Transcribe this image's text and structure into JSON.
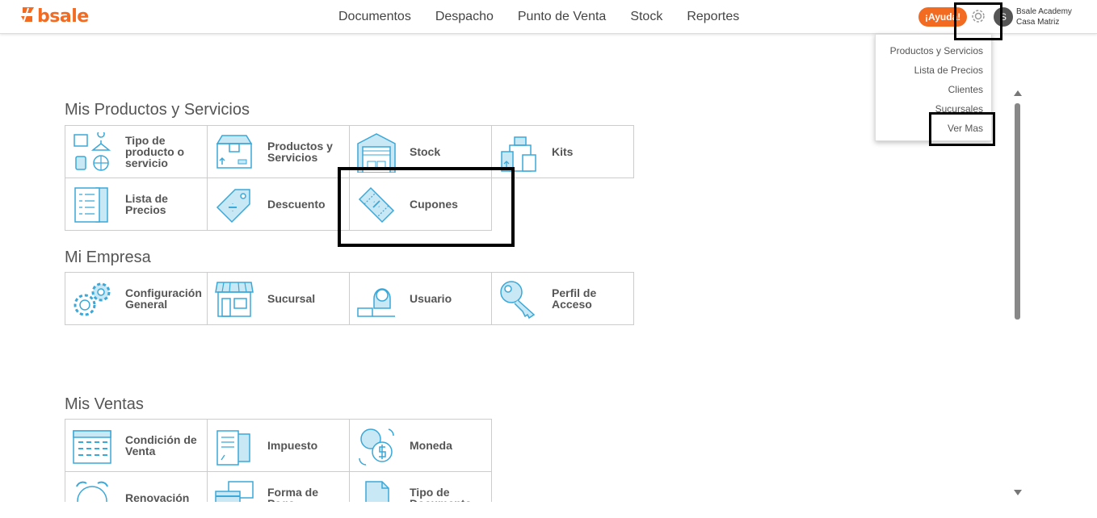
{
  "header": {
    "logo": "bsale",
    "nav": [
      "Documentos",
      "Despacho",
      "Punto de Venta",
      "Stock",
      "Reportes"
    ],
    "help": "¡Ayuda!",
    "avatar_initial": "S",
    "company_name": "Bsale Academy",
    "branch_name": "Casa Matriz"
  },
  "settings_menu": {
    "items": [
      "Productos y Servicios",
      "Lista de Precios",
      "Clientes",
      "Sucursales",
      "Ver Mas"
    ]
  },
  "sections": {
    "productos": {
      "title": "Mis Productos y Servicios",
      "tiles": [
        {
          "label": "Tipo de producto o servicio",
          "icon": "product-type-icon"
        },
        {
          "label": "Productos y Servicios",
          "icon": "box-icon"
        },
        {
          "label": "Stock",
          "icon": "warehouse-icon"
        },
        {
          "label": "Kits",
          "icon": "kits-icon"
        },
        {
          "label": "Lista de Precios",
          "icon": "price-list-icon"
        },
        {
          "label": "Descuento",
          "icon": "discount-tag-icon"
        },
        {
          "label": "Cupones",
          "icon": "coupon-icon"
        }
      ]
    },
    "empresa": {
      "title": "Mi Empresa",
      "tiles": [
        {
          "label": "Configuración General",
          "icon": "gears-icon"
        },
        {
          "label": "Sucursal",
          "icon": "store-icon"
        },
        {
          "label": "Usuario",
          "icon": "user-icon"
        },
        {
          "label": "Perfil de Acceso",
          "icon": "key-icon"
        }
      ]
    },
    "ventas": {
      "title": "Mis Ventas",
      "tiles": [
        {
          "label": "Condición de Venta",
          "icon": "calendar-icon"
        },
        {
          "label": "Impuesto",
          "icon": "tax-icon"
        },
        {
          "label": "Moneda",
          "icon": "currency-icon"
        },
        {
          "label": "Renovación",
          "icon": "clock-icon"
        },
        {
          "label": "Forma de Pago",
          "icon": "payment-icon"
        },
        {
          "label": "Tipo de Documento",
          "icon": "document-icon"
        }
      ]
    }
  },
  "colors": {
    "accent": "#f36a21",
    "icon": "#3aa8d8"
  }
}
